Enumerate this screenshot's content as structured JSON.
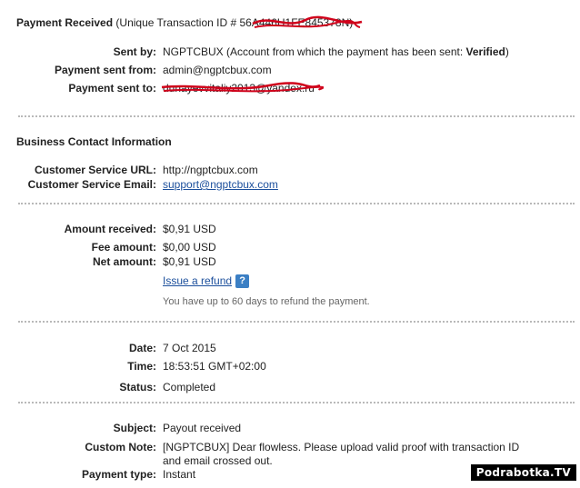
{
  "header": {
    "title": "Payment Received",
    "txn_prefix": "(Unique Transaction ID #",
    "txn_id": "56A446U1FE845378N",
    "txn_suffix": ")"
  },
  "payment": {
    "sent_by_label": "Sent by:",
    "sent_by_value": "NGPTCBUX",
    "sent_by_note_prefix": "(Account from which the payment has been sent:",
    "sent_by_status": "Verified",
    "sent_by_note_suffix": ")",
    "from_label": "Payment sent from:",
    "from_value": "admin@ngptcbux.com",
    "to_label": "Payment sent to:",
    "to_value": "dunayevvitaliy2013@yandex.ru"
  },
  "business": {
    "heading": "Business Contact Information",
    "url_label": "Customer Service URL:",
    "url_value": "http://ngptcbux.com",
    "email_label": "Customer Service Email:",
    "email_value": "support@ngptcbux.com"
  },
  "amounts": {
    "received_label": "Amount received:",
    "received_value": "$0,91 USD",
    "fee_label": "Fee amount:",
    "fee_value": "$0,00 USD",
    "net_label": "Net amount:",
    "net_value": "$0,91 USD",
    "refund_link": "Issue a refund",
    "refund_note": "You have up to 60 days to refund the payment.",
    "help_icon_glyph": "?"
  },
  "details": {
    "date_label": "Date:",
    "date_value": "7 Oct 2015",
    "time_label": "Time:",
    "time_value": "18:53:51 GMT+02:00",
    "status_label": "Status:",
    "status_value": "Completed"
  },
  "message": {
    "subject_label": "Subject:",
    "subject_value": "Payout received",
    "note_label": "Custom Note:",
    "note_line1": "[NGPTCBUX] Dear flowless. Please upload valid proof with transaction ID",
    "note_line2": "and email crossed out.",
    "type_label": "Payment type:",
    "type_value": "Instant"
  },
  "watermark": "Podrabotka.TV",
  "colors": {
    "link": "#1c4f9c",
    "redaction": "#d0021b",
    "help_icon": "#3b7fc4"
  }
}
